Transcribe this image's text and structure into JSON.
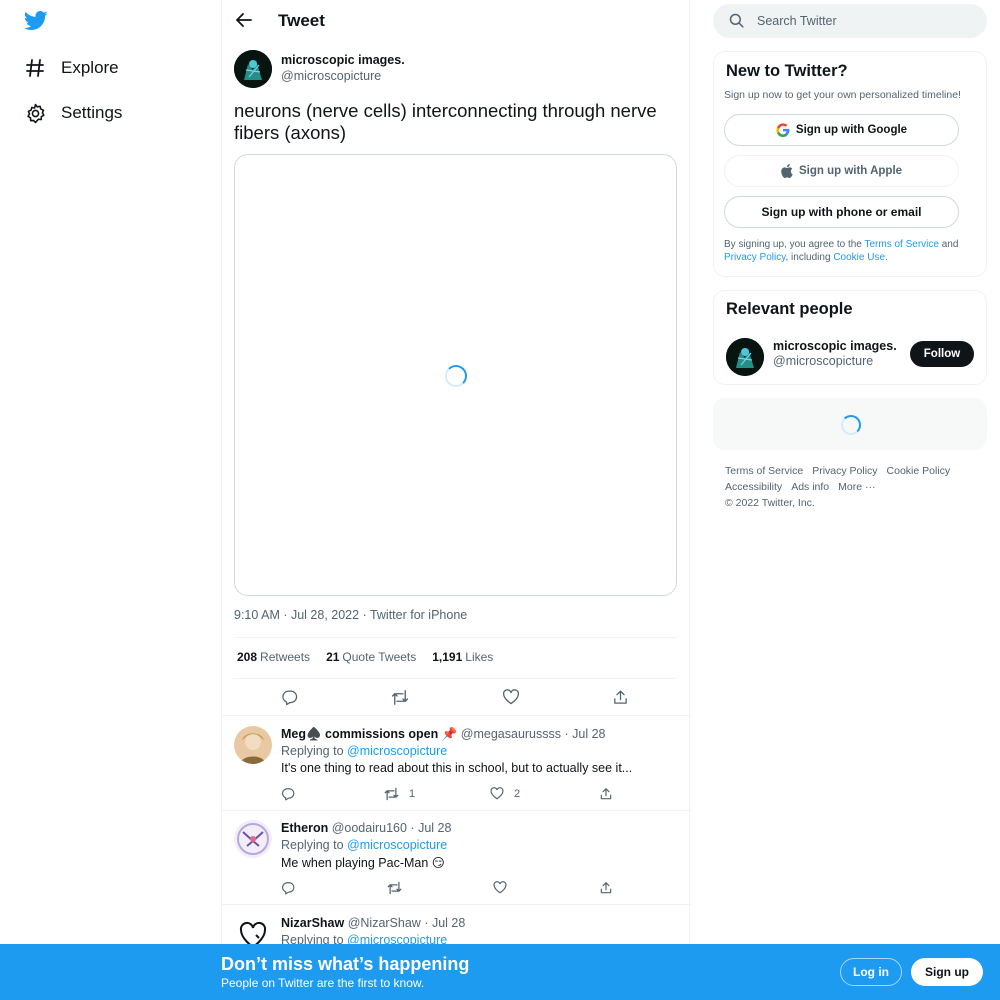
{
  "nav": {
    "logo_icon": "twitter-bird-icon",
    "items": [
      {
        "label": "Explore",
        "icon": "hashtag-icon"
      },
      {
        "label": "Settings",
        "icon": "gear-icon"
      }
    ]
  },
  "header": {
    "title": "Tweet"
  },
  "tweet": {
    "author_name": "microscopic images.",
    "author_handle": "@microscopicture",
    "text": "neurons (nerve cells) interconnecting through nerve fibers (axons)",
    "meta": "9:10 AM · Jul 28, 2022 · Twitter for iPhone",
    "stats": {
      "retweets_count": "208",
      "retweets_label": "Retweets",
      "quotes_count": "21",
      "quotes_label": "Quote Tweets",
      "likes_count": "1,191",
      "likes_label": "Likes"
    }
  },
  "replies": [
    {
      "name": "Meg♠️ commissions open 📌",
      "handle": "@megasaurussss",
      "date": "· Jul 28",
      "replying_label": "Replying to",
      "replying_handle": "@microscopicture",
      "text": "It's one thing to read about this in school, but to actually see it...",
      "retweets": "1",
      "likes": "2"
    },
    {
      "name": "Etheron",
      "handle": "@oodairu160",
      "date": "· Jul 28",
      "replying_label": "Replying to",
      "replying_handle": "@microscopicture",
      "text": "Me when playing Pac-Man 😏",
      "retweets": "",
      "likes": ""
    },
    {
      "name": "NizarShaw",
      "handle": "@NizarShaw",
      "date": "· Jul 28",
      "replying_label": "Replying to",
      "replying_handle": "@microscopicture",
      "text": "",
      "retweets": "",
      "likes": ""
    }
  ],
  "search": {
    "placeholder": "Search Twitter"
  },
  "new_to_twitter": {
    "title": "New to Twitter?",
    "subtitle": "Sign up now to get your own personalized timeline!",
    "google_label": "Sign up with Google",
    "apple_label": "Sign up with Apple",
    "phone_label": "Sign up with phone or email",
    "legal_prefix": "By signing up, you agree to the",
    "terms_link": "Terms of Service",
    "legal_and": "and",
    "privacy_link": "Privacy Policy",
    "legal_including": ", including",
    "cookie_link": "Cookie Use",
    "legal_end": "."
  },
  "relevant_people": {
    "title": "Relevant people",
    "name": "microscopic images.",
    "handle": "@microscopicture",
    "follow_label": "Follow"
  },
  "footer": {
    "links": [
      "Terms of Service",
      "Privacy Policy",
      "Cookie Policy",
      "Accessibility",
      "Ads info",
      "More ···"
    ],
    "copyright": "© 2022 Twitter, Inc."
  },
  "banner": {
    "title": "Don’t miss what’s happening",
    "subtitle": "People on Twitter are the first to know.",
    "login_label": "Log in",
    "signup_label": "Sign up"
  },
  "colors": {
    "accent": "#1d9bf0",
    "text": "#0f1419",
    "muted": "#536471",
    "border": "#eff3f4"
  }
}
